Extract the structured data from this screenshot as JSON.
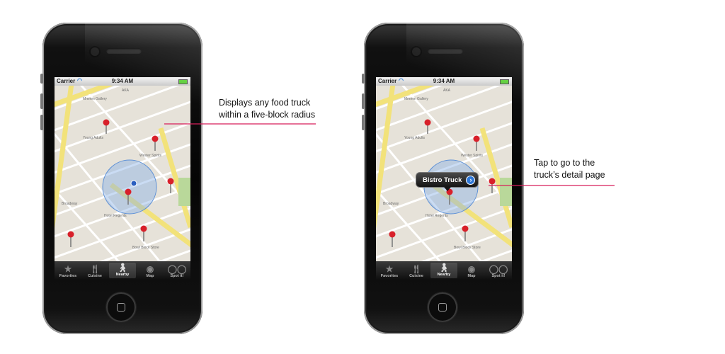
{
  "phones": [
    {
      "status": {
        "carrier": "Carrier",
        "time": "9:34 AM"
      },
      "tabs": [
        {
          "label": "Favorites",
          "icon": "star-icon"
        },
        {
          "label": "Cuisine",
          "icon": "fork-knife-icon"
        },
        {
          "label": "Nearby",
          "icon": "walking-person-icon",
          "active": true
        },
        {
          "label": "Map",
          "icon": "globe-icon"
        },
        {
          "label": "Spot it!",
          "icon": "glasses-icon"
        }
      ]
    },
    {
      "status": {
        "carrier": "Carrier",
        "time": "9:34 AM"
      },
      "callout": {
        "label": "Bistro Truck"
      },
      "tabs": [
        {
          "label": "Favorites",
          "icon": "star-icon"
        },
        {
          "label": "Cuisine",
          "icon": "fork-knife-icon"
        },
        {
          "label": "Nearby",
          "icon": "walking-person-icon",
          "active": true
        },
        {
          "label": "Map",
          "icon": "globe-icon"
        },
        {
          "label": "Spot it!",
          "icon": "glasses-icon"
        }
      ]
    }
  ],
  "annotations": {
    "left": [
      "Displays any food truck",
      "within a five-block radius"
    ],
    "right": [
      "Tap to go to the",
      "truck’s detail page"
    ]
  },
  "colors": {
    "pin": "#d8202a",
    "radius_circle": "#5b8fd6",
    "leader_line": "#d81e5b",
    "highway": "#f2e27a"
  }
}
